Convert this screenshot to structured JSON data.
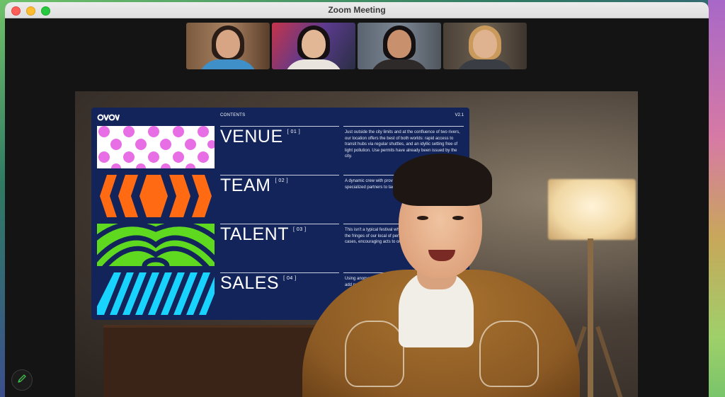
{
  "window": {
    "title": "Zoom Meeting"
  },
  "colors": {
    "pink": "#e86ee6",
    "orange": "#ff6a13",
    "green": "#5fd820",
    "cyan": "#19d3ff",
    "slide_bg": "#12245a"
  },
  "participants": [
    {
      "id": "p1"
    },
    {
      "id": "p2"
    },
    {
      "id": "p3"
    },
    {
      "id": "p4"
    }
  ],
  "slide": {
    "contents_label": "CONTENTS",
    "version": "V2.1",
    "rows": [
      {
        "title": "VENUE",
        "num": "[ 01 ]",
        "desc": "Just outside the city limits and at the confluence of two rivers, our location offers the best of both worlds: rapid access to transit hubs via regular shuttles, and an idyllic setting free of light pollution. Use permits have already been issued by the city."
      },
      {
        "title": "TEAM",
        "num": "[ 02 ]",
        "desc": "A dynamic crew with proven production, cultural curation specialized partners to tackle and health and safety."
      },
      {
        "title": "TALENT",
        "num": "[ 03 ]",
        "desc": "This isn't a typical festival who of chart-toppers. Our explore the fringes of our local of performers spanning genres many cases, encouraging acts to one-off performances."
      },
      {
        "title": "SALES",
        "num": "[ 04 ]",
        "desc": "Using anonymized data by our ticketing partner without any add projections year's"
      }
    ]
  },
  "controls": {
    "edit_icon": "pencil-icon"
  }
}
